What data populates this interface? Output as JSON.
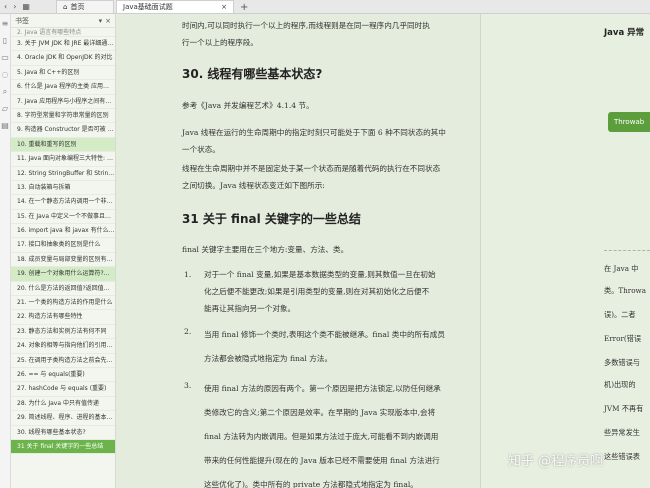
{
  "tabs": {
    "home": "首页",
    "active": "Java基础面试题",
    "plus": "+"
  },
  "sidebar": {
    "header": "书签",
    "items": [
      {
        "label": "2. Java 语言有哪些特点",
        "state": "top"
      },
      {
        "label": "3. 关于 JVM JDK 和 JRE 最详细通俗的解答",
        "state": ""
      },
      {
        "label": "4. Oracle JDK 和 OpenJDK 的对比",
        "state": ""
      },
      {
        "label": "5. Java 和 C++的区别",
        "state": ""
      },
      {
        "label": "6. 什么是 Java 程序的主类 应用程序和小程序的主类有何不同",
        "state": ""
      },
      {
        "label": "7. Java 应用程序与小程序之间有哪些差别",
        "state": ""
      },
      {
        "label": "8. 字符型常量和字符串常量的区别",
        "state": ""
      },
      {
        "label": "9. 构造器 Constructor 是否可被 override",
        "state": ""
      },
      {
        "label": "10. 重载和重写的区别",
        "state": "hl"
      },
      {
        "label": "11. Java 面向对象编程三大特性: 封装 继承 多态",
        "state": ""
      },
      {
        "label": "12. String StringBuffer 和 StringBuilder 的区别是什么",
        "state": ""
      },
      {
        "label": "13. 自动装箱与拆箱",
        "state": ""
      },
      {
        "label": "14. 在一个静态方法内调用一个非静态成员为什么是非法的",
        "state": ""
      },
      {
        "label": "15. 在 Java 中定义一个不做事且没有参数的构造方法的作用",
        "state": ""
      },
      {
        "label": "16. import java 和 javax 有什么区别",
        "state": ""
      },
      {
        "label": "17. 接口和抽象类的区别是什么",
        "state": ""
      },
      {
        "label": "18. 成员变量与局部变量的区别有哪些",
        "state": ""
      },
      {
        "label": "19. 创建一个对象用什么运算符?对象实体与对象引用有何不同",
        "state": "hl"
      },
      {
        "label": "20. 什么是方法的返回值?返回值在类的方法里的作用是什么",
        "state": ""
      },
      {
        "label": "21. 一个类的构造方法的作用是什么",
        "state": ""
      },
      {
        "label": "22. 构造方法有哪些特性",
        "state": ""
      },
      {
        "label": "23. 静态方法和实例方法有何不同",
        "state": ""
      },
      {
        "label": "24. 对象的相等与指向他们的引用相等,两者有什么不同",
        "state": ""
      },
      {
        "label": "25. 在调用子类构造方法之前会先调用父类没有参数的构造方法",
        "state": ""
      },
      {
        "label": "26. == 与 equals(重要)",
        "state": ""
      },
      {
        "label": "27. hashCode 与 equals (重要)",
        "state": ""
      },
      {
        "label": "28. 为什么 Java 中只有值传递",
        "state": ""
      },
      {
        "label": "29. 简述线程、程序、进程的基本概念",
        "state": ""
      },
      {
        "label": "30. 线程有哪些基本状态?",
        "state": ""
      },
      {
        "label": "31 关于 final 关键字的一些总结",
        "state": "active"
      }
    ]
  },
  "doc": {
    "intro_line1": "时间内,可以同时执行一个以上的程序,而线程则是在同一程序内几乎同时执",
    "intro_line2": "行一个以上的程序段。",
    "h30": "30. 线程有哪些基本状态?",
    "ref": "参考《Java 并发编程艺术》4.1.4 节。",
    "p1_line1": "Java 线程在运行的生命周期中的指定时刻只可能处于下面 6 种不同状态的其中",
    "p1_line2": "一个状态。",
    "p2_line1": "线程在生命周期中并不是固定处于某一个状态而是随着代码的执行在不同状态",
    "p2_line2": "之间切换。Java 线程状态变迁如下图所示:",
    "h31": "31 关于 final 关键字的一些总结",
    "final_intro": "final 关键字主要用在三个地方:变量、方法、类。",
    "items": [
      {
        "num": "1.",
        "lines": [
          "对于一个 final 变量,如果是基本数据类型的变量,则其数值一旦在初始",
          "化之后便不能更改;如果是引用类型的变量,则在对其初始化之后便不",
          "能再让其指向另一个对象。"
        ]
      },
      {
        "num": "2.",
        "lines": [
          "当用 final 修饰一个类时,表明这个类不能被继承。final 类中的所有成员",
          "方法都会被隐式地指定为 final 方法。"
        ]
      },
      {
        "num": "3.",
        "lines": [
          "使用 final 方法的原因有两个。第一个原因是把方法锁定,以防任何继承",
          "类修改它的含义;第二个原因是效率。在早期的 Java 实现版本中,会将",
          "final 方法转为内嵌调用。但是如果方法过于庞大,可能看不到内嵌调用",
          "带来的任何性能提升(现在的 Java 版本已经不需要使用 final 方法进行",
          "这些优化了)。类中所有的 private 方法都隐式地指定为 final。"
        ]
      }
    ]
  },
  "right": {
    "title": "Java 异常",
    "badge": "Throwab",
    "line1": "在 Java 中",
    "line2": "类。Throwa",
    "line3": "误)。二者",
    "line4": "Error(错误",
    "line5": "多数错误与",
    "line6": "机)出现的",
    "line7": "JVM 不再有",
    "line8": "些异常发生",
    "line9": "这些错误表"
  },
  "watermark": "知乎 @程序员啊"
}
